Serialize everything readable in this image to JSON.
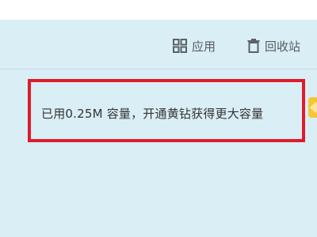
{
  "toolbar": {
    "apps_label": "应用",
    "apps_icon": "grid-icon",
    "recycle_label": "回收站",
    "recycle_icon": "trash-icon"
  },
  "storage": {
    "usage_text": "已用0.25M 容量，开通黄钻获得更大容量",
    "vip_icon": "yellow-diamond-icon"
  },
  "colors": {
    "panel_bg": "#daeef5",
    "highlight_border": "#e01a2c",
    "vip_yellow": "#f5c63a"
  }
}
